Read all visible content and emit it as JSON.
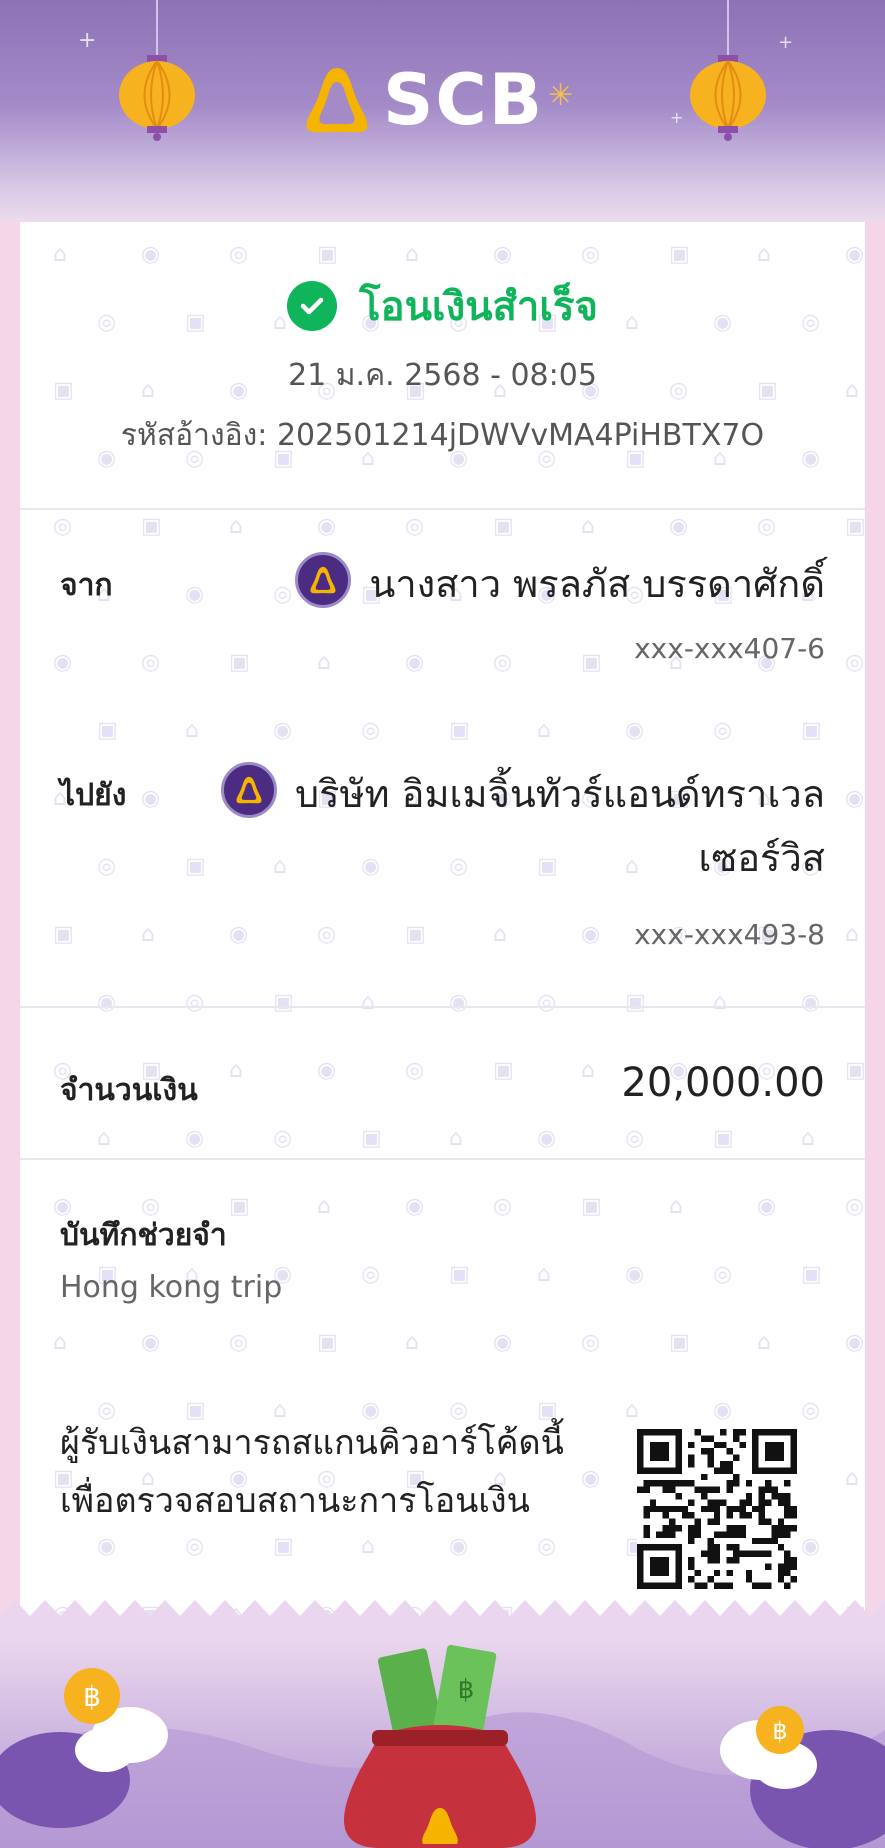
{
  "brand": {
    "name": "SCB"
  },
  "status": {
    "label": "โอนเงินสำเร็จ",
    "color": "#10b55b"
  },
  "datetime": "21 ม.ค. 2568 - 08:05",
  "reference": "รหัสอ้างอิง: 202501214jDWVvMA4PiHBTX7O",
  "from": {
    "label": "จาก",
    "name": "นางสาว พรลภัส บรรดาศักดิ์",
    "account": "xxx-xxx407-6"
  },
  "to": {
    "label": "ไปยัง",
    "name_line1": "บริษัท อิมเมจิ้นทัวร์แอนด์ทราเวล",
    "name_line2": "เซอร์วิส",
    "account": "xxx-xxx493-8"
  },
  "amount": {
    "label": "จำนวนเงิน",
    "value": "20,000.00"
  },
  "memo": {
    "label": "บันทึกช่วยจำ",
    "value": "Hong kong trip"
  },
  "qr": {
    "line1": "ผู้รับเงินสามารถสแกนคิวอาร์โค้ดนี้",
    "line2": "เพื่อตรวจสอบสถานะการโอนเงิน"
  },
  "icons": [
    "lantern-icon",
    "scb-logo-icon",
    "check-circle-icon",
    "bank-avatar-icon",
    "qr-code-icon",
    "money-bag-icon",
    "coin-icon",
    "cloud-icon"
  ],
  "colors": {
    "header": "#8d72b6",
    "brand_purple": "#4b2c82",
    "gold": "#f5b400",
    "success": "#10b55b"
  }
}
